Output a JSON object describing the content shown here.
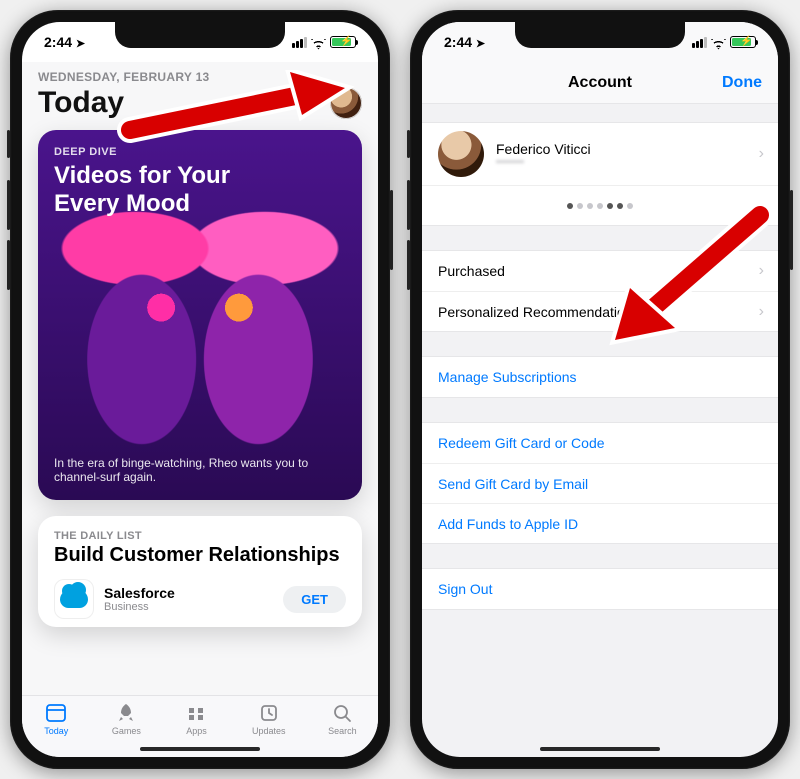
{
  "status": {
    "time": "2:44",
    "location_glyph": "➤"
  },
  "left": {
    "date": "WEDNESDAY, FEBRUARY 13",
    "title": "Today",
    "hero": {
      "eyebrow": "DEEP DIVE",
      "title": "Videos for Your Every Mood",
      "caption": "In the era of binge-watching, Rheo wants you to channel-surf again."
    },
    "list_card": {
      "eyebrow": "THE DAILY LIST",
      "title": "Build Customer Relationships",
      "app": {
        "name": "Salesforce",
        "subtitle": "Business",
        "action": "GET"
      }
    },
    "tabs": [
      {
        "label": "Today"
      },
      {
        "label": "Games"
      },
      {
        "label": "Apps"
      },
      {
        "label": "Updates"
      },
      {
        "label": "Search"
      }
    ]
  },
  "right": {
    "nav": {
      "title": "Account",
      "done": "Done"
    },
    "profile": {
      "name": "Federico Viticci",
      "email": "••••••••"
    },
    "group2": [
      {
        "label": "Purchased"
      },
      {
        "label": "Personalized Recommendations"
      }
    ],
    "group3": [
      {
        "label": "Manage Subscriptions"
      }
    ],
    "group4": [
      {
        "label": "Redeem Gift Card or Code"
      },
      {
        "label": "Send Gift Card by Email"
      },
      {
        "label": "Add Funds to Apple ID"
      }
    ],
    "group5": [
      {
        "label": "Sign Out"
      }
    ]
  }
}
